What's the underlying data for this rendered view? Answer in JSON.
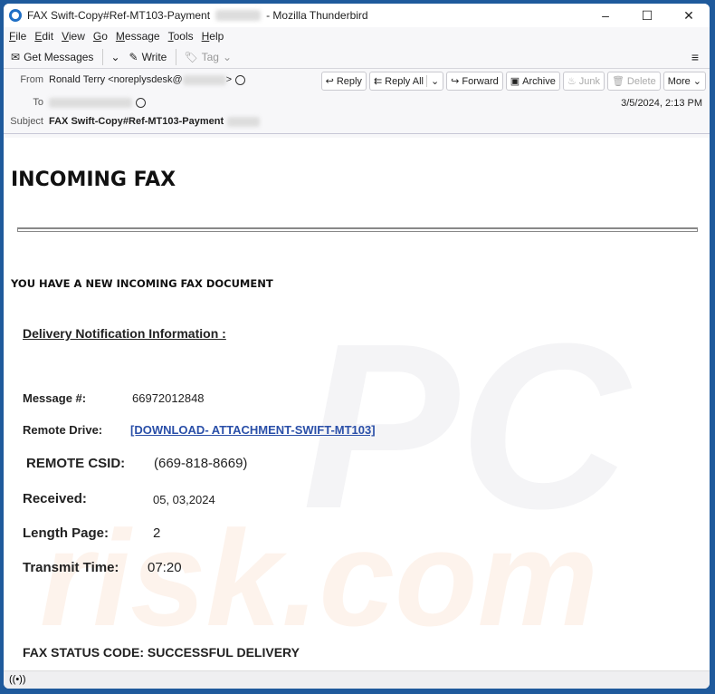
{
  "window": {
    "title_prefix": "FAX Swift-Copy#Ref-MT103-Payment",
    "title_suffix": "- Mozilla Thunderbird",
    "controls": {
      "minimize": "–",
      "maximize": "☐",
      "close": "✕"
    }
  },
  "menu": [
    "File",
    "Edit",
    "View",
    "Go",
    "Message",
    "Tools",
    "Help"
  ],
  "toolbar": {
    "get_messages": "Get Messages",
    "write": "Write",
    "tag": "Tag",
    "menu_icon": "≡"
  },
  "header": {
    "from_label": "From",
    "from_value": "Ronald Terry <noreplysdesk@",
    "from_suffix": ">",
    "to_label": "To",
    "subject_label": "Subject",
    "subject_value": "FAX Swift-Copy#Ref-MT103-Payment",
    "date": "3/5/2024, 2:13 PM",
    "actions": {
      "reply": "Reply",
      "reply_all": "Reply All",
      "forward": "Forward",
      "archive": "Archive",
      "junk": "Junk",
      "delete": "Delete",
      "more": "More"
    }
  },
  "email": {
    "heading": "INCOMING FAX",
    "notice": "YOU HAVE A NEW INCOMING FAX DOCUMENT",
    "section_title": "Delivery Notification Information :",
    "fields": {
      "message_label": "Message #:",
      "message_value": "66972012848",
      "drive_label": "Remote Drive:",
      "drive_value": "[DOWNLOAD- ATTACHMENT-SWIFT-MT103]",
      "csid_label": "REMOTE CSID:",
      "csid_value": "(669-818-8669)",
      "received_label": "Received:",
      "received_value": "05, 03,2024",
      "length_label": "Length Page:",
      "length_value": "2",
      "transmit_label": "Transmit Time:",
      "transmit_value": "07:20"
    },
    "status": "FAX STATUS CODE:  SUCCESSFUL DELIVERY"
  },
  "watermark": {
    "line1": "PC",
    "line2": "risk.com"
  },
  "statusbar": {
    "icon": "((•))"
  }
}
